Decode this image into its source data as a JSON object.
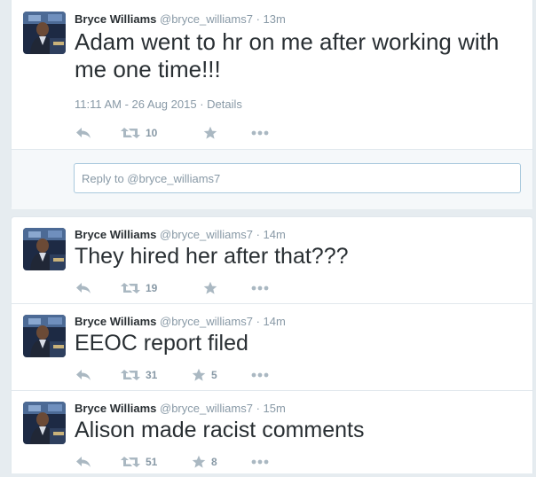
{
  "main_tweet": {
    "name": "Bryce Williams",
    "handle": "@bryce_williams7",
    "dot": "·",
    "time": "13m",
    "text": "Adam went to hr on me after working with me one time!!!",
    "timestamp": "11:11 AM - 26 Aug 2015",
    "details_sep": "·",
    "details": "Details",
    "retweets": "10",
    "reply_placeholder": "Reply to @bryce_williams7"
  },
  "thread": [
    {
      "name": "Bryce Williams",
      "handle": "@bryce_williams7",
      "dot": "·",
      "time": "14m",
      "text": "They hired her after that???",
      "retweets": "19",
      "favorites": ""
    },
    {
      "name": "Bryce Williams",
      "handle": "@bryce_williams7",
      "dot": "·",
      "time": "14m",
      "text": "EEOC report filed",
      "retweets": "31",
      "favorites": "5"
    },
    {
      "name": "Bryce Williams",
      "handle": "@bryce_williams7",
      "dot": "·",
      "time": "15m",
      "text": "Alison made racist comments",
      "retweets": "51",
      "favorites": "8"
    }
  ],
  "colors": {
    "background": "#e6ecf0",
    "text": "#292f33",
    "muted": "#8899a6",
    "link": "#2b7bb9",
    "icon": "#aab8c2"
  },
  "icons": [
    "reply-icon",
    "retweet-icon",
    "favorite-icon",
    "more-icon"
  ]
}
